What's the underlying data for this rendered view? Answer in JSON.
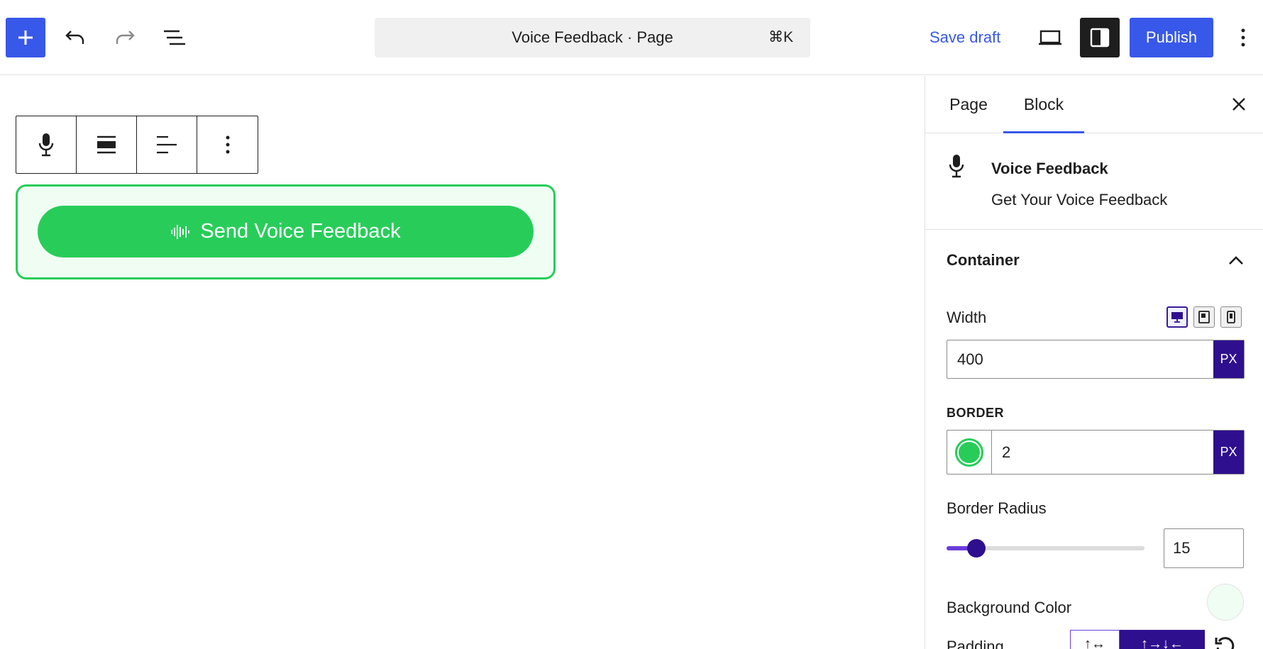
{
  "topbar": {
    "document_title": "Voice Feedback · Page",
    "shortcut": "⌘K",
    "save_draft_label": "Save draft",
    "publish_label": "Publish",
    "icons": [
      "plus-icon",
      "undo-icon",
      "redo-icon",
      "list-view-icon",
      "desktop-view-icon",
      "sidebar-settings-icon",
      "more-vertical-icon"
    ]
  },
  "block_toolbar": {
    "icons": [
      "microphone-icon",
      "align-center-icon",
      "text-align-left-icon",
      "more-vertical-icon"
    ]
  },
  "canvas": {
    "button_label": "Send Voice Feedback",
    "button_color": "#28cd59",
    "container_background": "#effdf3"
  },
  "sidebar": {
    "tabs": [
      {
        "label": "Page",
        "active": false
      },
      {
        "label": "Block",
        "active": true
      }
    ],
    "block": {
      "title": "Voice Feedback",
      "description": "Get Your Voice Feedback"
    },
    "panel": {
      "title": "Container",
      "expanded": true,
      "width_label": "Width",
      "width_value": "400",
      "width_unit": "PX",
      "device_options": [
        "desktop",
        "tablet",
        "mobile"
      ],
      "active_device": "desktop",
      "border_label": "BORDER",
      "border_color": "#28cd59",
      "border_value": "2",
      "border_unit": "PX",
      "radius_label": "Border Radius",
      "radius_value": "15",
      "radius_fraction": 0.15,
      "background_label": "Background Color",
      "background_color": "#effdf3",
      "padding_label": "Padding"
    }
  },
  "colors": {
    "accent": "#3858e9",
    "unit_badge": "#2e0f8e",
    "slider": "#6c3cdc"
  }
}
